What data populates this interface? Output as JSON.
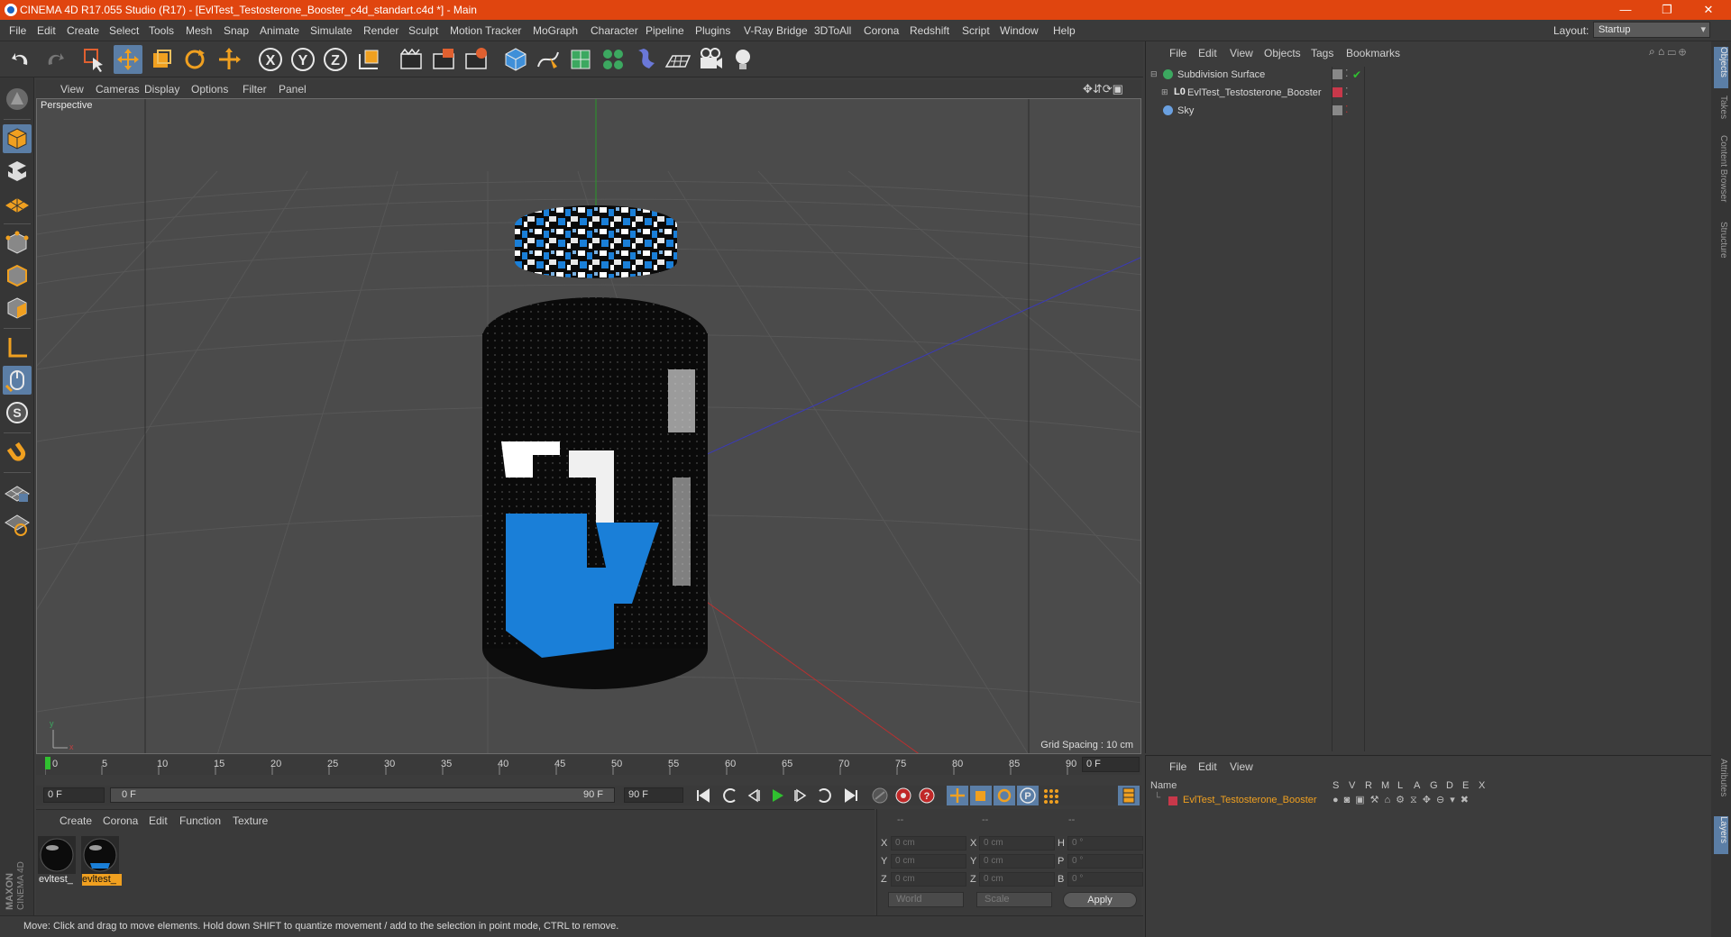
{
  "window": {
    "title": "CINEMA 4D R17.055 Studio (R17) - [EvlTest_Testosterone_Booster_c4d_standart.c4d *] - Main",
    "minimize": "—",
    "maximize": "❐",
    "close": "✕"
  },
  "menu": [
    "File",
    "Edit",
    "Create",
    "Select",
    "Tools",
    "Mesh",
    "Snap",
    "Animate",
    "Simulate",
    "Render",
    "Sculpt",
    "Motion Tracker",
    "MoGraph",
    "Character",
    "Pipeline",
    "Plugins",
    "V-Ray Bridge",
    "3DToAll",
    "Corona",
    "Redshift",
    "Script",
    "Window",
    "Help"
  ],
  "layout": {
    "label": "Layout:",
    "value": "Startup"
  },
  "toolbar": [
    "undo-icon",
    "redo-icon",
    "live-selection-icon",
    "move-icon",
    "scale-icon",
    "rotate-icon",
    "transform-icon",
    "x-axis-lock-icon",
    "y-axis-lock-icon",
    "z-axis-lock-icon",
    "world-coordinates-icon",
    "render-view-icon",
    "render-picture-viewer-icon",
    "edit-render-settings-icon",
    "cube-primitive-icon",
    "spline-pen-icon",
    "subdivision-surface-icon",
    "cloner-icon",
    "deformer-icon",
    "floor-icon",
    "camera-icon",
    "light-icon"
  ],
  "left_toolbar": [
    "make-editable-icon",
    "model-mode-icon",
    "texture-mode-icon",
    "workplane-icon",
    "points-mode-icon",
    "edges-mode-icon",
    "polygons-mode-icon",
    "axis-mode-icon",
    "tweak-mode-icon",
    "snapping-icon",
    "magnet-icon",
    "grid-lock-icon",
    "solo-icon"
  ],
  "viewport": {
    "menu": [
      "View",
      "Cameras",
      "Display",
      "Options",
      "Filter",
      "Panel"
    ],
    "camera_label": "Perspective",
    "grid_spacing": "Grid Spacing : 10 cm"
  },
  "timeline": {
    "ticks": [
      "0",
      "5",
      "10",
      "15",
      "20",
      "25",
      "30",
      "35",
      "40",
      "45",
      "50",
      "55",
      "60",
      "65",
      "70",
      "75",
      "80",
      "85",
      "90"
    ],
    "current_frame": "0 F",
    "start": "0 F",
    "range_start": "0 F",
    "range_end": "90 F",
    "end": "90 F"
  },
  "material_manager": {
    "menu": [
      "Create",
      "Corona",
      "Edit",
      "Function",
      "Texture"
    ],
    "materials": [
      {
        "label": "evltest_",
        "selected": false
      },
      {
        "label": "evltest_",
        "selected": true
      }
    ]
  },
  "coordinates": {
    "headers": [
      "--",
      "--",
      "--"
    ],
    "rows": [
      {
        "a": "X",
        "av": "0 cm",
        "b": "X",
        "bv": "0 cm",
        "c": "H",
        "cv": "0 °"
      },
      {
        "a": "Y",
        "av": "0 cm",
        "b": "Y",
        "bv": "0 cm",
        "c": "P",
        "cv": "0 °"
      },
      {
        "a": "Z",
        "av": "0 cm",
        "b": "Z",
        "bv": "0 cm",
        "c": "B",
        "cv": "0 °"
      }
    ],
    "space": "World",
    "mode": "Scale",
    "apply": "Apply"
  },
  "status": "Move: Click and drag to move elements. Hold down SHIFT to quantize movement / add to the selection in point mode, CTRL to remove.",
  "maxon": "MAXON CINEMA 4D",
  "object_manager": {
    "menu": [
      "File",
      "Edit",
      "View",
      "Objects",
      "Tags",
      "Bookmarks"
    ],
    "objects": [
      {
        "name": "Subdivision Surface",
        "icon": "subdivision-icon"
      },
      {
        "name": "EvlTest_Testosterone_Booster",
        "icon": "null-object-icon"
      },
      {
        "name": "Sky",
        "icon": "sky-icon"
      }
    ]
  },
  "side_tabs": [
    "Objects",
    "Takes",
    "Content Browser",
    "Structure"
  ],
  "side_tabs_bottom": [
    "Attributes",
    "Layers"
  ],
  "layer_manager": {
    "menu": [
      "File",
      "Edit",
      "View"
    ],
    "columns": [
      "Name",
      "S",
      "V",
      "R",
      "M",
      "L",
      "A",
      "G",
      "D",
      "E",
      "X"
    ],
    "layers": [
      {
        "name": "EvlTest_Testosterone_Booster",
        "color": "#c8384a"
      }
    ]
  },
  "colors": {
    "accent": "#5b7ea6",
    "title_bar": "#e0450f",
    "selected_text": "#f0a020"
  }
}
